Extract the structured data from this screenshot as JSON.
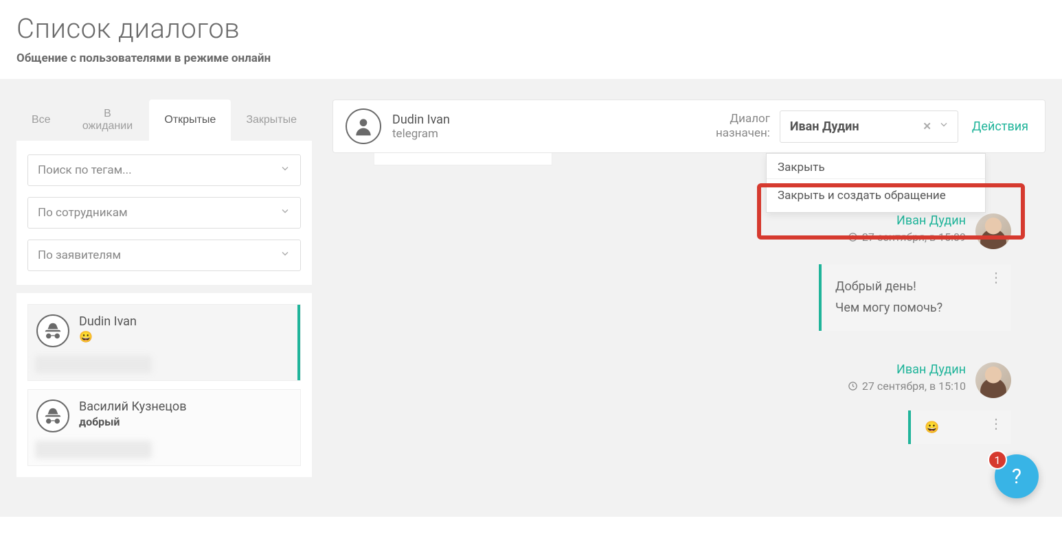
{
  "header": {
    "title": "Список диалогов",
    "subtitle": "Общение с пользователями в режиме онлайн"
  },
  "tabs": {
    "all": "Все",
    "pending": "В ожидании",
    "open": "Открытые",
    "closed": "Закрытые"
  },
  "filters": {
    "tags_placeholder": "Поиск по тегам...",
    "staff_placeholder": "По сотрудникам",
    "clients_placeholder": "По заявителям"
  },
  "dialogs": {
    "items": [
      {
        "name": "Dudin Ivan",
        "preview": "😀",
        "bold": false
      },
      {
        "name": "Василий Кузнецов",
        "preview": "добрый",
        "bold": true
      }
    ]
  },
  "chat": {
    "user_name": "Dudin Ivan",
    "channel": "telegram",
    "assigned_label_line1": "Диалог",
    "assigned_label_line2": "назначен:",
    "assigned_to": "Иван Дудин",
    "actions_label": "Действия",
    "dropdown": {
      "close": "Закрыть",
      "close_create": "Закрыть и создать обращение"
    },
    "messages": [
      {
        "sender": "Иван Дудин",
        "time": "27 сентября, в 15:09",
        "lines": [
          "Добрый день!",
          "Чем могу помочь?"
        ]
      },
      {
        "sender": "Иван Дудин",
        "time": "27 сентября, в 15:10"
      }
    ]
  },
  "fab": {
    "badge": "1",
    "label": "?"
  },
  "colors": {
    "accent": "#20b49a",
    "danger": "#d63a2f",
    "help": "#38b4e6"
  }
}
